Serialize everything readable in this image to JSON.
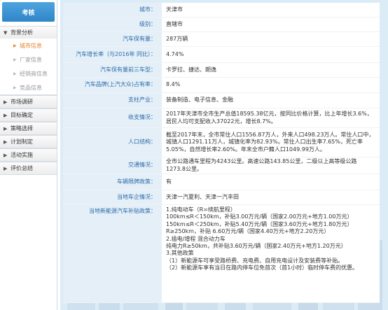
{
  "sidebar": {
    "header": "考核",
    "groups": [
      {
        "title": "背景分析",
        "expanded": true,
        "items": [
          {
            "label": "城市信息",
            "active": true
          },
          {
            "label": "厂家信息",
            "active": false
          },
          {
            "label": "经销商信息",
            "active": false
          },
          {
            "label": "竞品信息",
            "active": false
          }
        ]
      },
      {
        "title": "市场调研",
        "expanded": false
      },
      {
        "title": "目标确定",
        "expanded": false
      },
      {
        "title": "策略选择",
        "expanded": false
      },
      {
        "title": "计划制定",
        "expanded": false
      },
      {
        "title": "活动实施",
        "expanded": false
      },
      {
        "title": "评价总结",
        "expanded": false
      }
    ]
  },
  "info": {
    "city": {
      "label": "城市：",
      "value": "天津市"
    },
    "level": {
      "label": "级别：",
      "value": "直辖市"
    },
    "stock": {
      "label": "汽车保有量：",
      "value": "287万辆"
    },
    "growth": {
      "label": "汽车增长率（与2016年 同比）：",
      "value": "4.74%"
    },
    "top3": {
      "label": "汽车保有量前三车型：",
      "value": "卡罗拉、捷达、朗逸"
    },
    "share": {
      "label": "汽车品牌(上汽大众)占有率：",
      "value": "8.4%"
    },
    "industry": {
      "label": "支柱产业：",
      "value": "装备制造、电子信息、金融"
    },
    "income": {
      "label": "收支情况：",
      "value": "2017年天津市全市生产总值18595.38亿元，按同比价格计算，比上年增长3.6%，居民人均可支配收入37022元，增长8.7%。"
    },
    "population": {
      "label": "人口结构：",
      "value": "截至2017年末，全市常住人口1556.87万人，外来人口498.23万人。常住人口中，城镇人口1291.11万人，城镇化率为82.93%。常住人口出生率7.65%，死亡率5.05%，自然增长率2.60%。年末全市户籍人口1049.99万人。"
    },
    "traffic": {
      "label": "交通情况：",
      "value": "全市公路通车里程为4243公里。高速公路143.85公里，二级以上高等级公路1273.8公里。"
    },
    "limit": {
      "label": "车辆限牌政策：",
      "value": "有"
    },
    "factory": {
      "label": "当地车企情况：",
      "value": "天津一汽夏利、天津一汽丰田"
    },
    "subsidy": {
      "label": "当地新能源汽车补贴政策：",
      "lines": [
        "1.纯电动车（R=续航里程）",
        "100km≤R＜150km，补贴3.00万元/辆（国家2.00万元+地方1.00万元）",
        "150km≤R＜250km，补贴5.40万元/辆（国家3.60万元+地方1.80万元）",
        "R≥250km，补贴 6.60万元/辆（国家4.40万元+地方2.20万元）",
        "2.插电/增程 混合动力车",
        "纯电力R≥50km，共补贴3.60万元/辆（国家2.40万元+地方1.20万元）",
        "3.其他政策",
        "（1）新能源车可享受路桥费、充电费、自用充电设计及安装费等补贴。",
        "（2）新能源车享有当日在路内停车位免首次（首1小时）临时停车费的优惠。"
      ]
    }
  }
}
